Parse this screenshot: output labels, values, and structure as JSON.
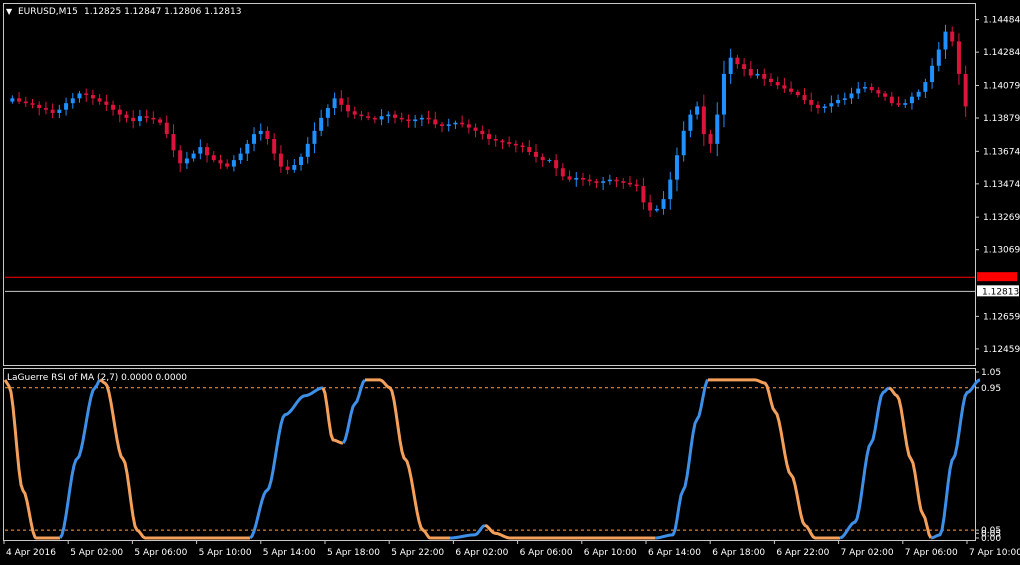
{
  "chart_data": [
    {
      "type": "candlestick",
      "symbol_label": "EURUSD,M15",
      "ohlc_header": "1.12825 1.12847 1.12806 1.12813",
      "up_color": "#1e90ff",
      "down_color": "#dc143c",
      "ylim": [
        1.1236,
        1.1458
      ],
      "y_ticks": [
        "1.14484",
        "1.14284",
        "1.14079",
        "1.13879",
        "1.13674",
        "1.13474",
        "1.13269",
        "1.13069",
        "1.12659",
        "1.12459"
      ],
      "current_price_label": "1.12813",
      "current_price": 1.12813,
      "bid_line": 1.129,
      "bid_line_color": "#ff0000",
      "closes": [
        1.14,
        1.1398,
        1.1397,
        1.1396,
        1.1394,
        1.1393,
        1.1391,
        1.1393,
        1.1397,
        1.14,
        1.1403,
        1.1402,
        1.14,
        1.1398,
        1.1396,
        1.1393,
        1.139,
        1.1388,
        1.1386,
        1.1389,
        1.1388,
        1.1387,
        1.1385,
        1.1378,
        1.1368,
        1.136,
        1.1363,
        1.1366,
        1.137,
        1.1365,
        1.1362,
        1.136,
        1.1358,
        1.1362,
        1.1366,
        1.1372,
        1.1378,
        1.138,
        1.1375,
        1.1366,
        1.1358,
        1.1356,
        1.1359,
        1.1364,
        1.1372,
        1.138,
        1.1388,
        1.1394,
        1.14,
        1.1396,
        1.1392,
        1.139,
        1.1389,
        1.1388,
        1.1387,
        1.1389,
        1.139,
        1.1388,
        1.1387,
        1.1386,
        1.1387,
        1.1388,
        1.1387,
        1.1384,
        1.1383,
        1.1384,
        1.1385,
        1.1384,
        1.1382,
        1.138,
        1.1378,
        1.1375,
        1.1374,
        1.1373,
        1.1372,
        1.1371,
        1.137,
        1.1367,
        1.1364,
        1.1362,
        1.1362,
        1.1357,
        1.1352,
        1.135,
        1.1351,
        1.135,
        1.1349,
        1.1348,
        1.1349,
        1.135,
        1.1349,
        1.1348,
        1.1347,
        1.1346,
        1.1336,
        1.1331,
        1.1332,
        1.1338,
        1.135,
        1.1365,
        1.138,
        1.139,
        1.1395,
        1.1378,
        1.1372,
        1.139,
        1.1415,
        1.1425,
        1.1421,
        1.1418,
        1.1414,
        1.1415,
        1.1412,
        1.141,
        1.1408,
        1.1406,
        1.1404,
        1.1402,
        1.1399,
        1.1396,
        1.1394,
        1.1395,
        1.1397,
        1.1399,
        1.14,
        1.1403,
        1.1406,
        1.1407,
        1.1405,
        1.1403,
        1.1401,
        1.1397,
        1.1396,
        1.1397,
        1.1401,
        1.1404,
        1.141,
        1.142,
        1.143,
        1.1441,
        1.1435,
        1.1415,
        1.1395
      ]
    },
    {
      "type": "line",
      "indicator_label": "LaGuerre RSI of MA (2,7) 0.0000 0.0000",
      "ylim": [
        0,
        1.05
      ],
      "y_ticks": [
        "1.05",
        "0.95",
        "0.05",
        "0.05",
        "0.00"
      ],
      "levels": [
        0.95,
        0.05
      ],
      "level_color": "#ffa040",
      "rising_color": "#3d8fe8",
      "falling_color": "#f5a05a",
      "keypoints": [
        [
          0,
          1.0
        ],
        [
          4,
          0.96
        ],
        [
          18,
          0.3
        ],
        [
          31,
          0.0
        ],
        [
          55,
          0.0
        ],
        [
          72,
          0.5
        ],
        [
          90,
          0.95
        ],
        [
          95,
          1.0
        ],
        [
          100,
          0.98
        ],
        [
          118,
          0.5
        ],
        [
          132,
          0.05
        ],
        [
          140,
          0.0
        ],
        [
          210,
          0.0
        ],
        [
          245,
          0.0
        ],
        [
          262,
          0.3
        ],
        [
          280,
          0.78
        ],
        [
          300,
          0.9
        ],
        [
          318,
          0.95
        ],
        [
          328,
          0.62
        ],
        [
          338,
          0.6
        ],
        [
          350,
          0.85
        ],
        [
          360,
          1.0
        ],
        [
          375,
          1.0
        ],
        [
          385,
          0.95
        ],
        [
          400,
          0.5
        ],
        [
          418,
          0.05
        ],
        [
          425,
          0.0
        ],
        [
          445,
          0.0
        ],
        [
          470,
          0.02
        ],
        [
          480,
          0.08
        ],
        [
          490,
          0.03
        ],
        [
          505,
          0.0
        ],
        [
          530,
          0.0
        ],
        [
          600,
          0.0
        ],
        [
          650,
          0.0
        ],
        [
          668,
          0.02
        ],
        [
          678,
          0.3
        ],
        [
          692,
          0.75
        ],
        [
          703,
          1.0
        ],
        [
          750,
          1.0
        ],
        [
          760,
          0.98
        ],
        [
          770,
          0.8
        ],
        [
          786,
          0.4
        ],
        [
          800,
          0.08
        ],
        [
          810,
          0.0
        ],
        [
          835,
          0.0
        ],
        [
          850,
          0.1
        ],
        [
          866,
          0.6
        ],
        [
          878,
          0.92
        ],
        [
          884,
          0.95
        ],
        [
          892,
          0.9
        ],
        [
          906,
          0.5
        ],
        [
          918,
          0.15
        ],
        [
          926,
          0.0
        ],
        [
          935,
          0.02
        ],
        [
          948,
          0.5
        ],
        [
          962,
          0.92
        ],
        [
          975,
          1.0
        ]
      ]
    }
  ],
  "time_axis": {
    "labels": [
      "4 Apr 2016",
      "5 Apr 02:00",
      "5 Apr 06:00",
      "5 Apr 10:00",
      "5 Apr 14:00",
      "5 Apr 18:00",
      "5 Apr 22:00",
      "6 Apr 02:00",
      "6 Apr 06:00",
      "6 Apr 10:00",
      "6 Apr 14:00",
      "6 Apr 18:00",
      "6 Apr 22:00",
      "7 Apr 02:00",
      "7 Apr 06:00",
      "7 Apr 10:00"
    ]
  }
}
